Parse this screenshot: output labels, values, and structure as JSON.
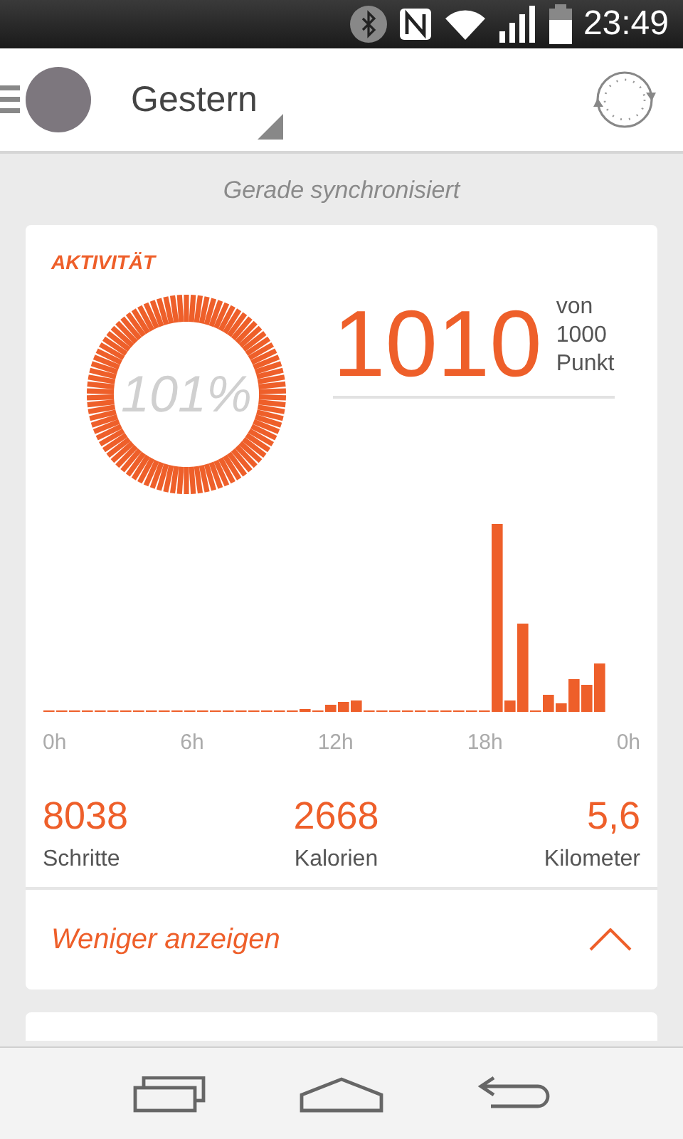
{
  "status_bar": {
    "time": "23:49"
  },
  "header": {
    "title": "Gestern"
  },
  "sync_status": "Gerade synchronisiert",
  "activity": {
    "title": "AKTIVITÄT",
    "ring": {
      "percent": "101%"
    },
    "points": "1010",
    "goal_line1": "von",
    "goal_line2": "1000",
    "goal_line3": "Punkt",
    "chart_axis": [
      "0h",
      "6h",
      "12h",
      "18h",
      "0h"
    ],
    "stats": [
      {
        "value": "8038",
        "label": "Schritte"
      },
      {
        "value": "2668",
        "label": "Kalorien"
      },
      {
        "value": "5,6",
        "label": "Kilometer"
      }
    ],
    "toggle": {
      "label": "Weniger anzeigen",
      "expanded": true
    }
  }
}
